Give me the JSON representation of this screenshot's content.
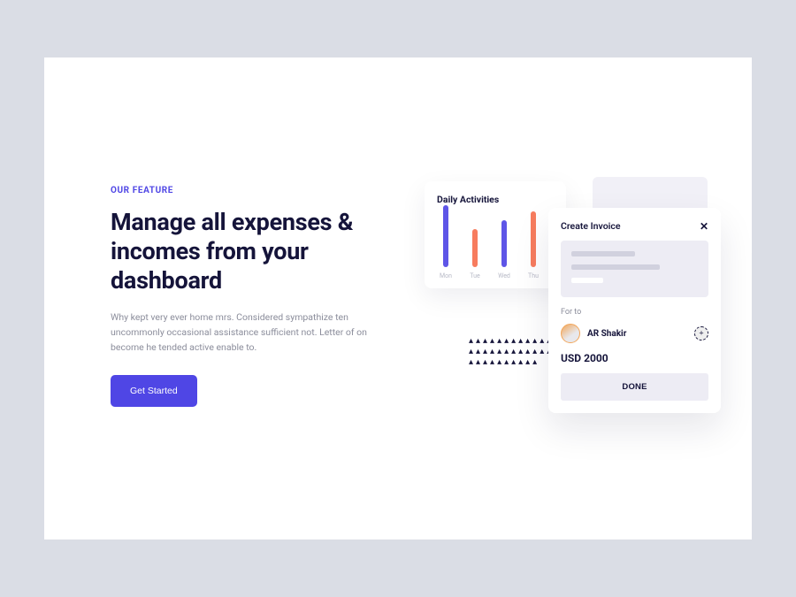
{
  "left": {
    "eyebrow": "OUR FEATURE",
    "headline": "Manage all expenses & incomes from your dashboard",
    "desc": "Why kept very ever home mrs. Considered sympathize ten uncommonly occasional assistance sufficient not. Letter of on become he tended active enable to.",
    "cta": "Get Started"
  },
  "chart_data": {
    "type": "bar",
    "title": "Daily Activities",
    "categories": [
      "Mon",
      "Tue",
      "Wed",
      "Thu"
    ],
    "values": [
      70,
      40,
      51,
      62
    ],
    "series_colors": [
      "purple",
      "orange",
      "purple",
      "orange"
    ]
  },
  "invoice": {
    "title": "Create Invoice",
    "forto_label": "For to",
    "user_name": "AR Shakir",
    "amount": "USD 2000",
    "done_label": "DONE"
  }
}
